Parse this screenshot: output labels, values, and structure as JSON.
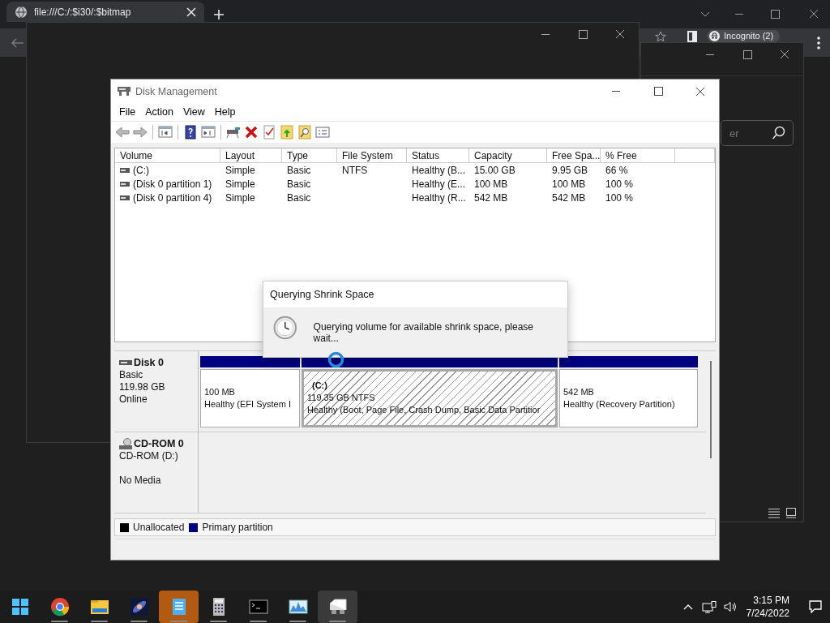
{
  "browser": {
    "tab_title": "file:///C:/:$i30/:$bitmap",
    "profile_label": "Incognito (2)"
  },
  "side_window": {
    "search_placeholder": "er"
  },
  "disk_management": {
    "title": "Disk Management",
    "menu": [
      "File",
      "Action",
      "View",
      "Help"
    ],
    "table": {
      "columns": [
        "Volume",
        "Layout",
        "Type",
        "File System",
        "Status",
        "Capacity",
        "Free Spa...",
        "% Free"
      ],
      "rows": [
        {
          "cells": [
            "(C:)",
            "Simple",
            "Basic",
            "NTFS",
            "Healthy (B...",
            "15.00 GB",
            "9.95 GB",
            "66 %"
          ]
        },
        {
          "cells": [
            "(Disk 0 partition 1)",
            "Simple",
            "Basic",
            "",
            "Healthy (E...",
            "100 MB",
            "100 MB",
            "100 %"
          ]
        },
        {
          "cells": [
            "(Disk 0 partition 4)",
            "Simple",
            "Basic",
            "",
            "Healthy (R...",
            "542 MB",
            "542 MB",
            "100 %"
          ]
        }
      ]
    },
    "disks": [
      {
        "kind": "disk",
        "name": "Disk 0",
        "details": [
          "Basic",
          "119.98 GB",
          "Online"
        ],
        "partitions": [
          {
            "size": "100 MB",
            "status": "Healthy (EFI System I",
            "selected": false
          },
          {
            "label": "(C:)",
            "size": "119.35 GB NTFS",
            "status": "Healthy (Boot, Page File, Crash Dump, Basic Data Partitior",
            "selected": true
          },
          {
            "size": "542 MB",
            "status": "Healthy (Recovery Partition)",
            "selected": false
          }
        ]
      },
      {
        "kind": "cdrom",
        "name": "CD-ROM 0",
        "details": [
          "CD-ROM (D:)",
          "No Media"
        ]
      }
    ],
    "legend": [
      {
        "label": "Unallocated",
        "color": "#000000"
      },
      {
        "label": "Primary partition",
        "color": "#000080"
      }
    ]
  },
  "dialog": {
    "title": "Querying Shrink Space",
    "message": "Querying volume for available shrink space, please wait..."
  },
  "taskbar": {
    "apps": [
      {
        "kind": "start",
        "running": false,
        "selected": false,
        "flashing": false
      },
      {
        "kind": "chrome",
        "running": true,
        "selected": false,
        "flashing": false
      },
      {
        "kind": "explorer",
        "running": true,
        "selected": false,
        "flashing": false
      },
      {
        "kind": "galaxy",
        "running": true,
        "selected": false,
        "flashing": false
      },
      {
        "kind": "notepad",
        "running": true,
        "selected": false,
        "flashing": true
      },
      {
        "kind": "calculator",
        "running": true,
        "selected": false,
        "flashing": false
      },
      {
        "kind": "terminal",
        "running": true,
        "selected": false,
        "flashing": false
      },
      {
        "kind": "monitor",
        "running": true,
        "selected": false,
        "flashing": false
      },
      {
        "kind": "diskmgmt",
        "running": true,
        "selected": true,
        "flashing": false
      }
    ],
    "clock": {
      "time": "3:15 PM",
      "date": "7/24/2022"
    }
  }
}
